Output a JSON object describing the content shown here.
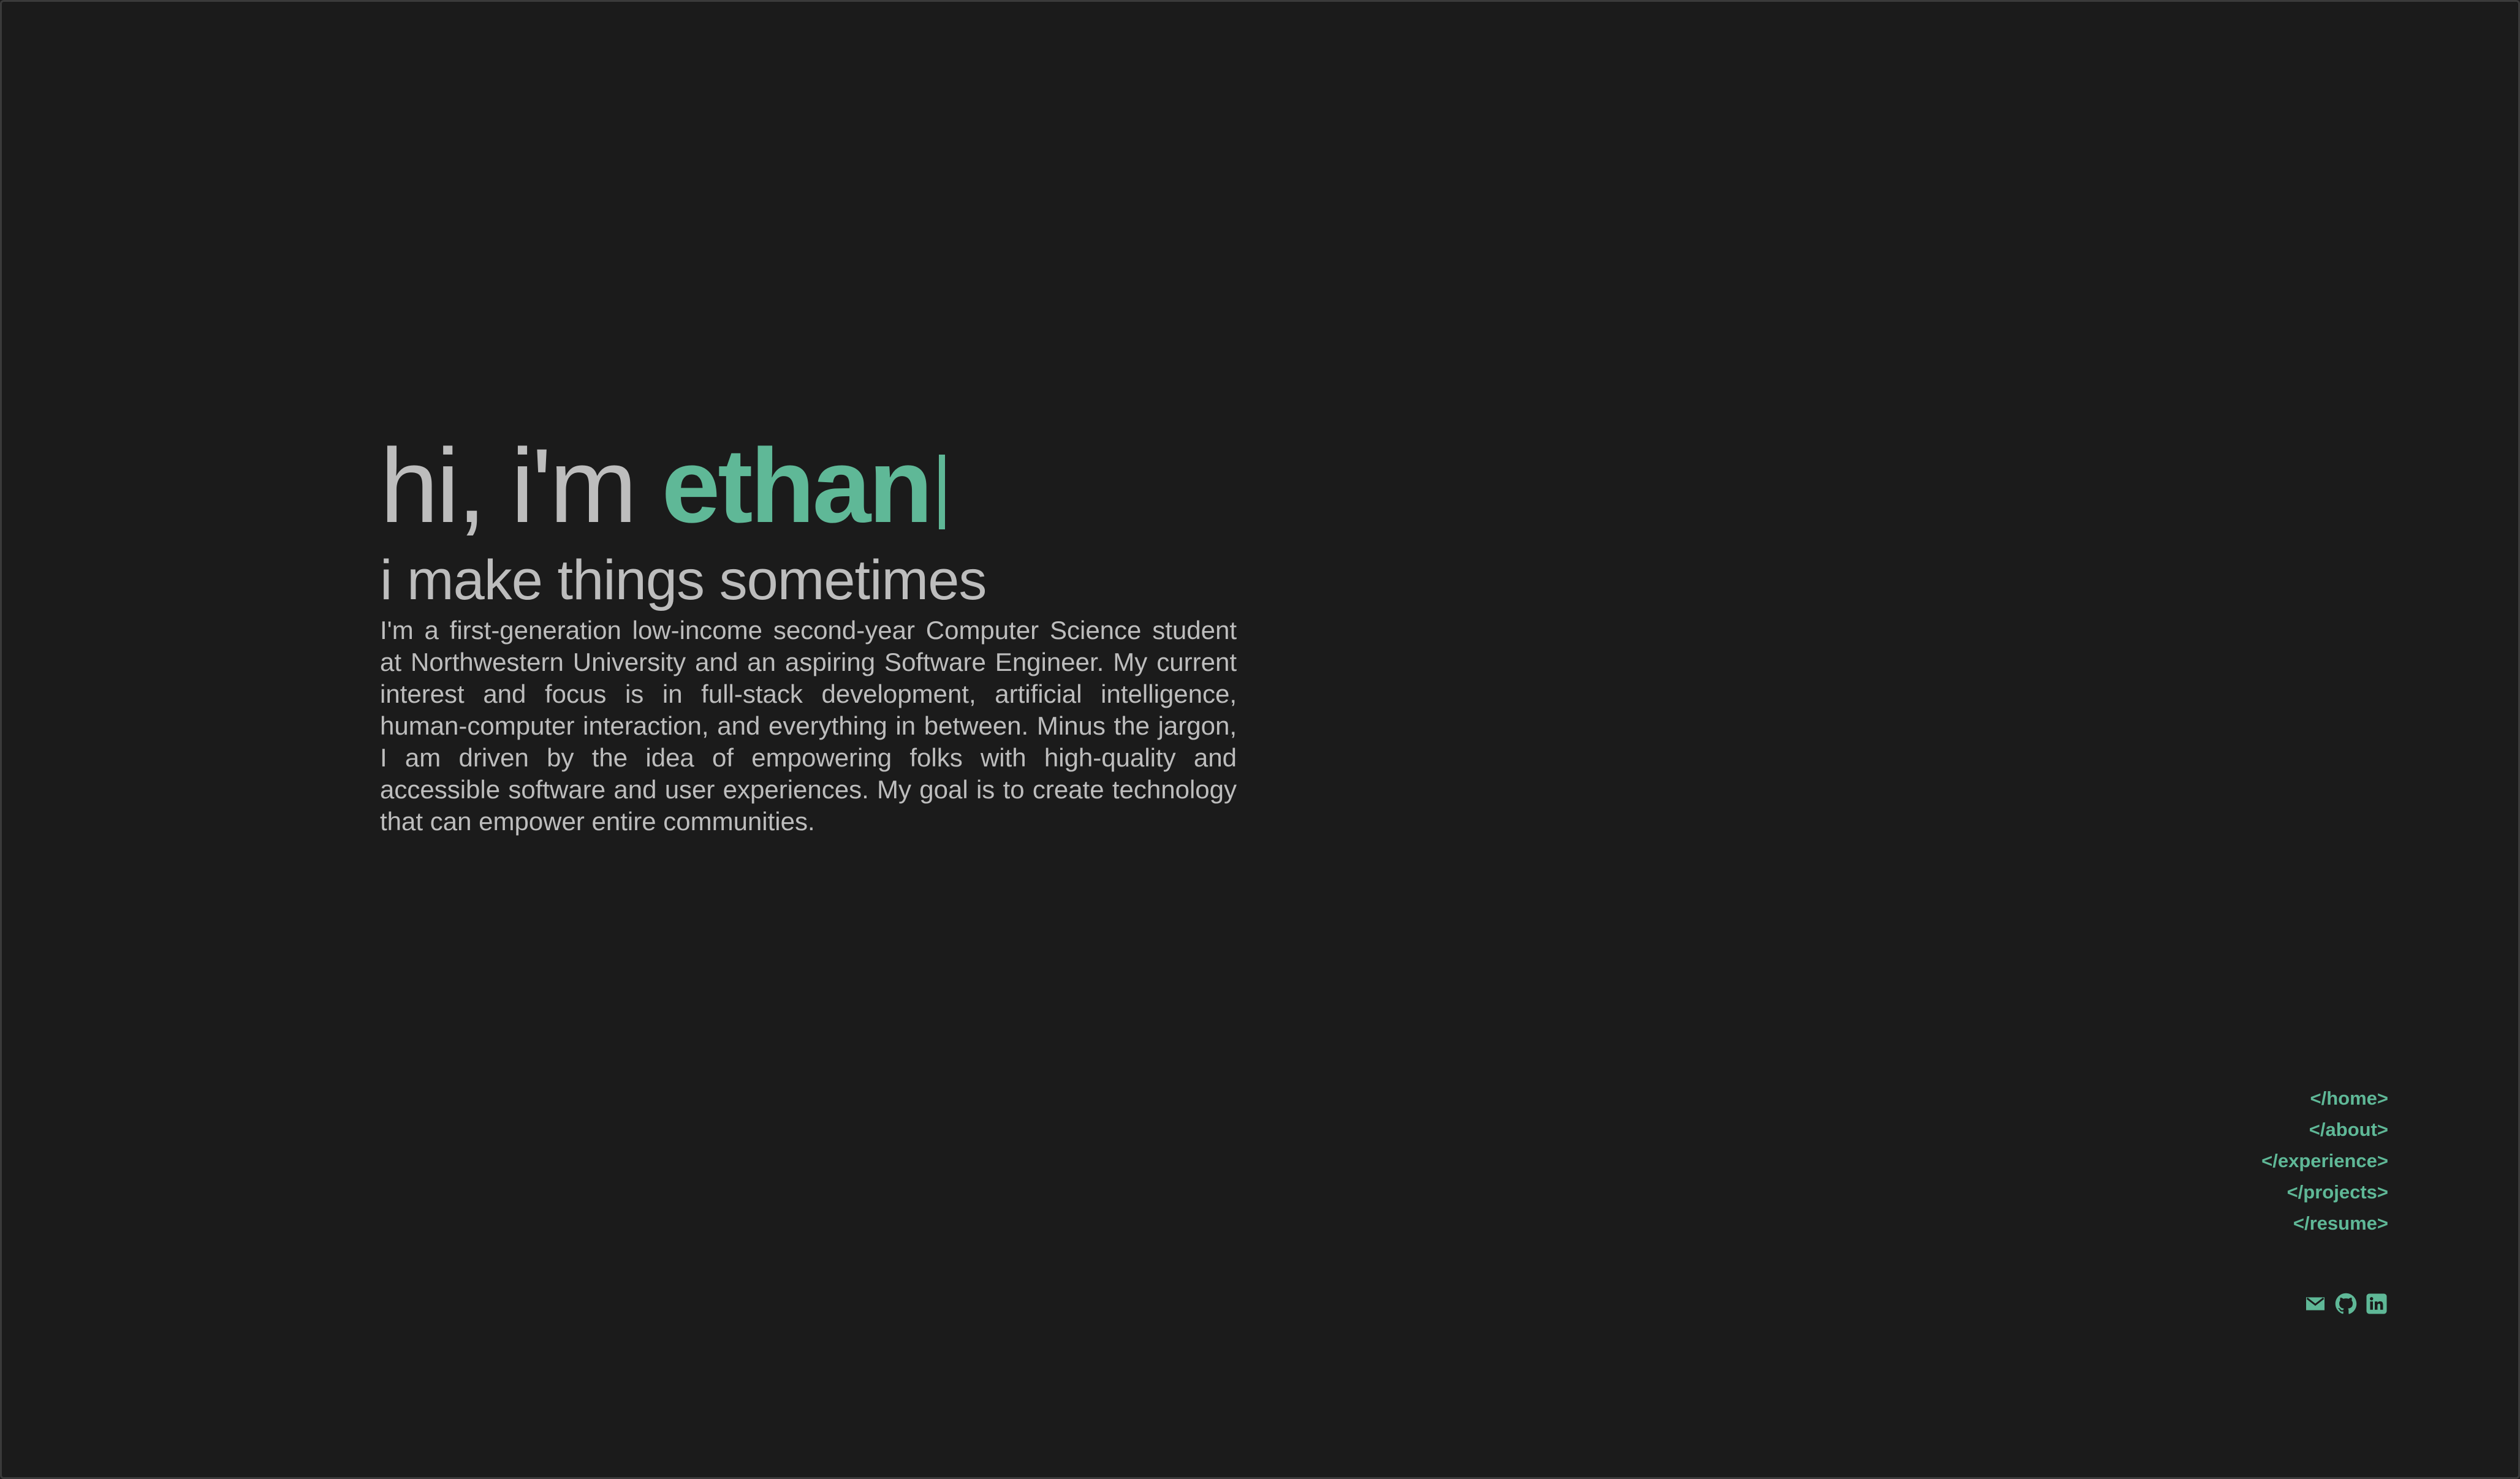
{
  "theme": {
    "background": "#1b1b1b",
    "text": "#bdbdbd",
    "accent": "#5fb897"
  },
  "hero": {
    "greeting": "hi, i'm ",
    "name": "ethan",
    "subtitle": "i make things sometimes",
    "bio": "I'm a first-generation low-income second-year Computer Science student at Northwestern University and an aspiring Software Engineer. My current interest and focus is in full-stack development, artificial intelligence, human-computer interaction, and everything in between. Minus the jargon, I am driven by the idea of empowering folks with high-quality and accessible software and user experiences. My goal is to create technology that can empower entire communities."
  },
  "nav": {
    "items": [
      {
        "label": "</home>"
      },
      {
        "label": "</about>"
      },
      {
        "label": "</experience>"
      },
      {
        "label": "</projects>"
      },
      {
        "label": "</resume>"
      }
    ]
  },
  "socials": {
    "icons": [
      "email-icon",
      "github-icon",
      "linkedin-icon"
    ]
  }
}
